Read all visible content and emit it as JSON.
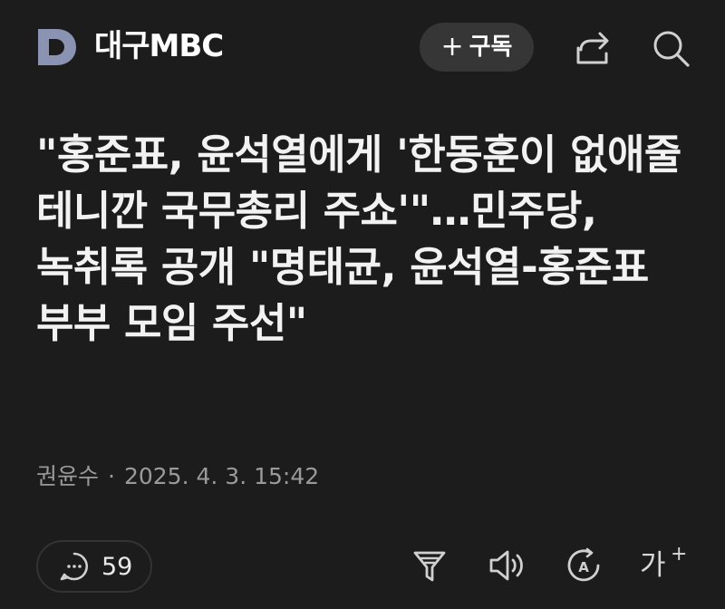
{
  "header": {
    "logo_icon": "d-logo-icon",
    "brand": "대구MBC",
    "subscribe_plus": "+",
    "subscribe_label": "구독",
    "share_icon": "share-icon",
    "search_icon": "search-icon"
  },
  "article": {
    "headline": "\"홍준표, 윤석열에게 '한동훈이 없애줄 테니깐 국무총리 주쇼'\"…민주당, 녹취록 공개 \"명태균, 윤석열-홍준표 부부 모임 주선\"",
    "author": "권윤수",
    "separator": "·",
    "date": "2025. 4. 3. 15:42"
  },
  "toolbar": {
    "comment_icon": "comment-icon",
    "comment_count": "59",
    "summary_icon": "summary-icon",
    "speaker_icon": "speaker-icon",
    "translate_icon": "translate-icon",
    "fontsize_label": "가",
    "fontsize_sup": "+"
  },
  "colors": {
    "background": "#1c1c1c",
    "logo": "#8a93b2",
    "pill": "#363636",
    "meta_text": "#9a9a9a"
  }
}
